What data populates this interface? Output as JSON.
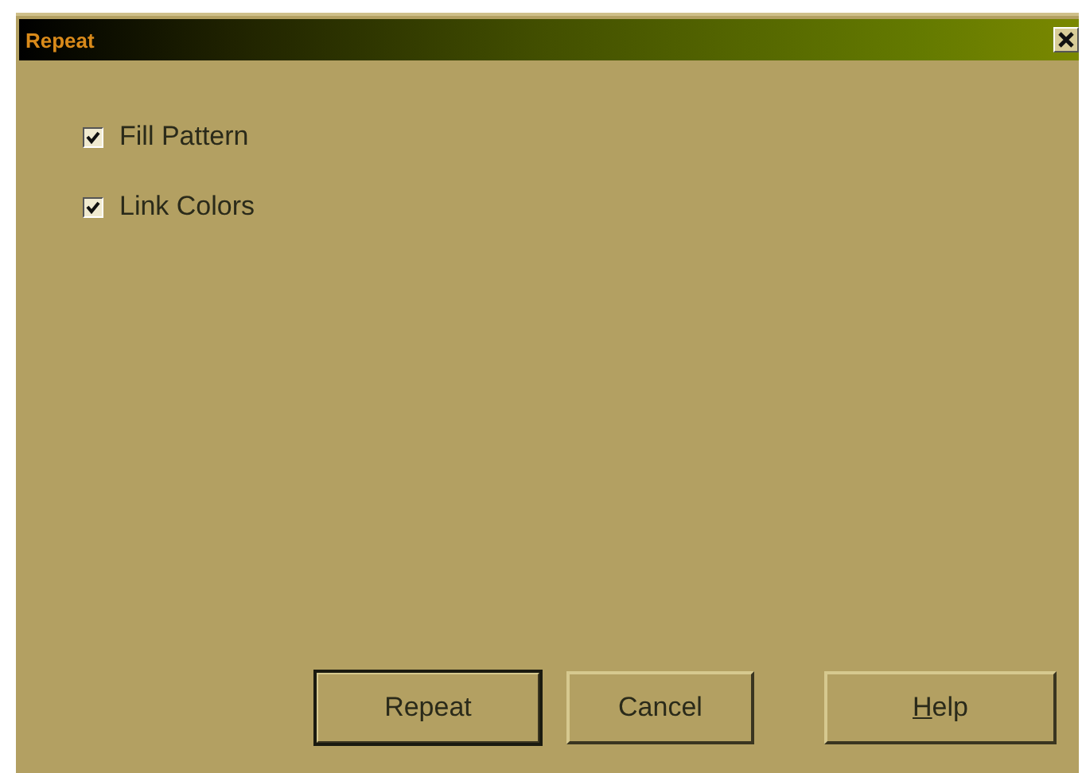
{
  "window": {
    "title": "Repeat"
  },
  "options": [
    {
      "label": "Fill Pattern",
      "checked": true
    },
    {
      "label": "Link Colors",
      "checked": true
    }
  ],
  "buttons": [
    {
      "label": "Repeat",
      "default": true,
      "underline_first": false
    },
    {
      "label": "Cancel",
      "default": false,
      "underline_first": false
    },
    {
      "label": "Help",
      "default": false,
      "underline_first": true
    }
  ]
}
